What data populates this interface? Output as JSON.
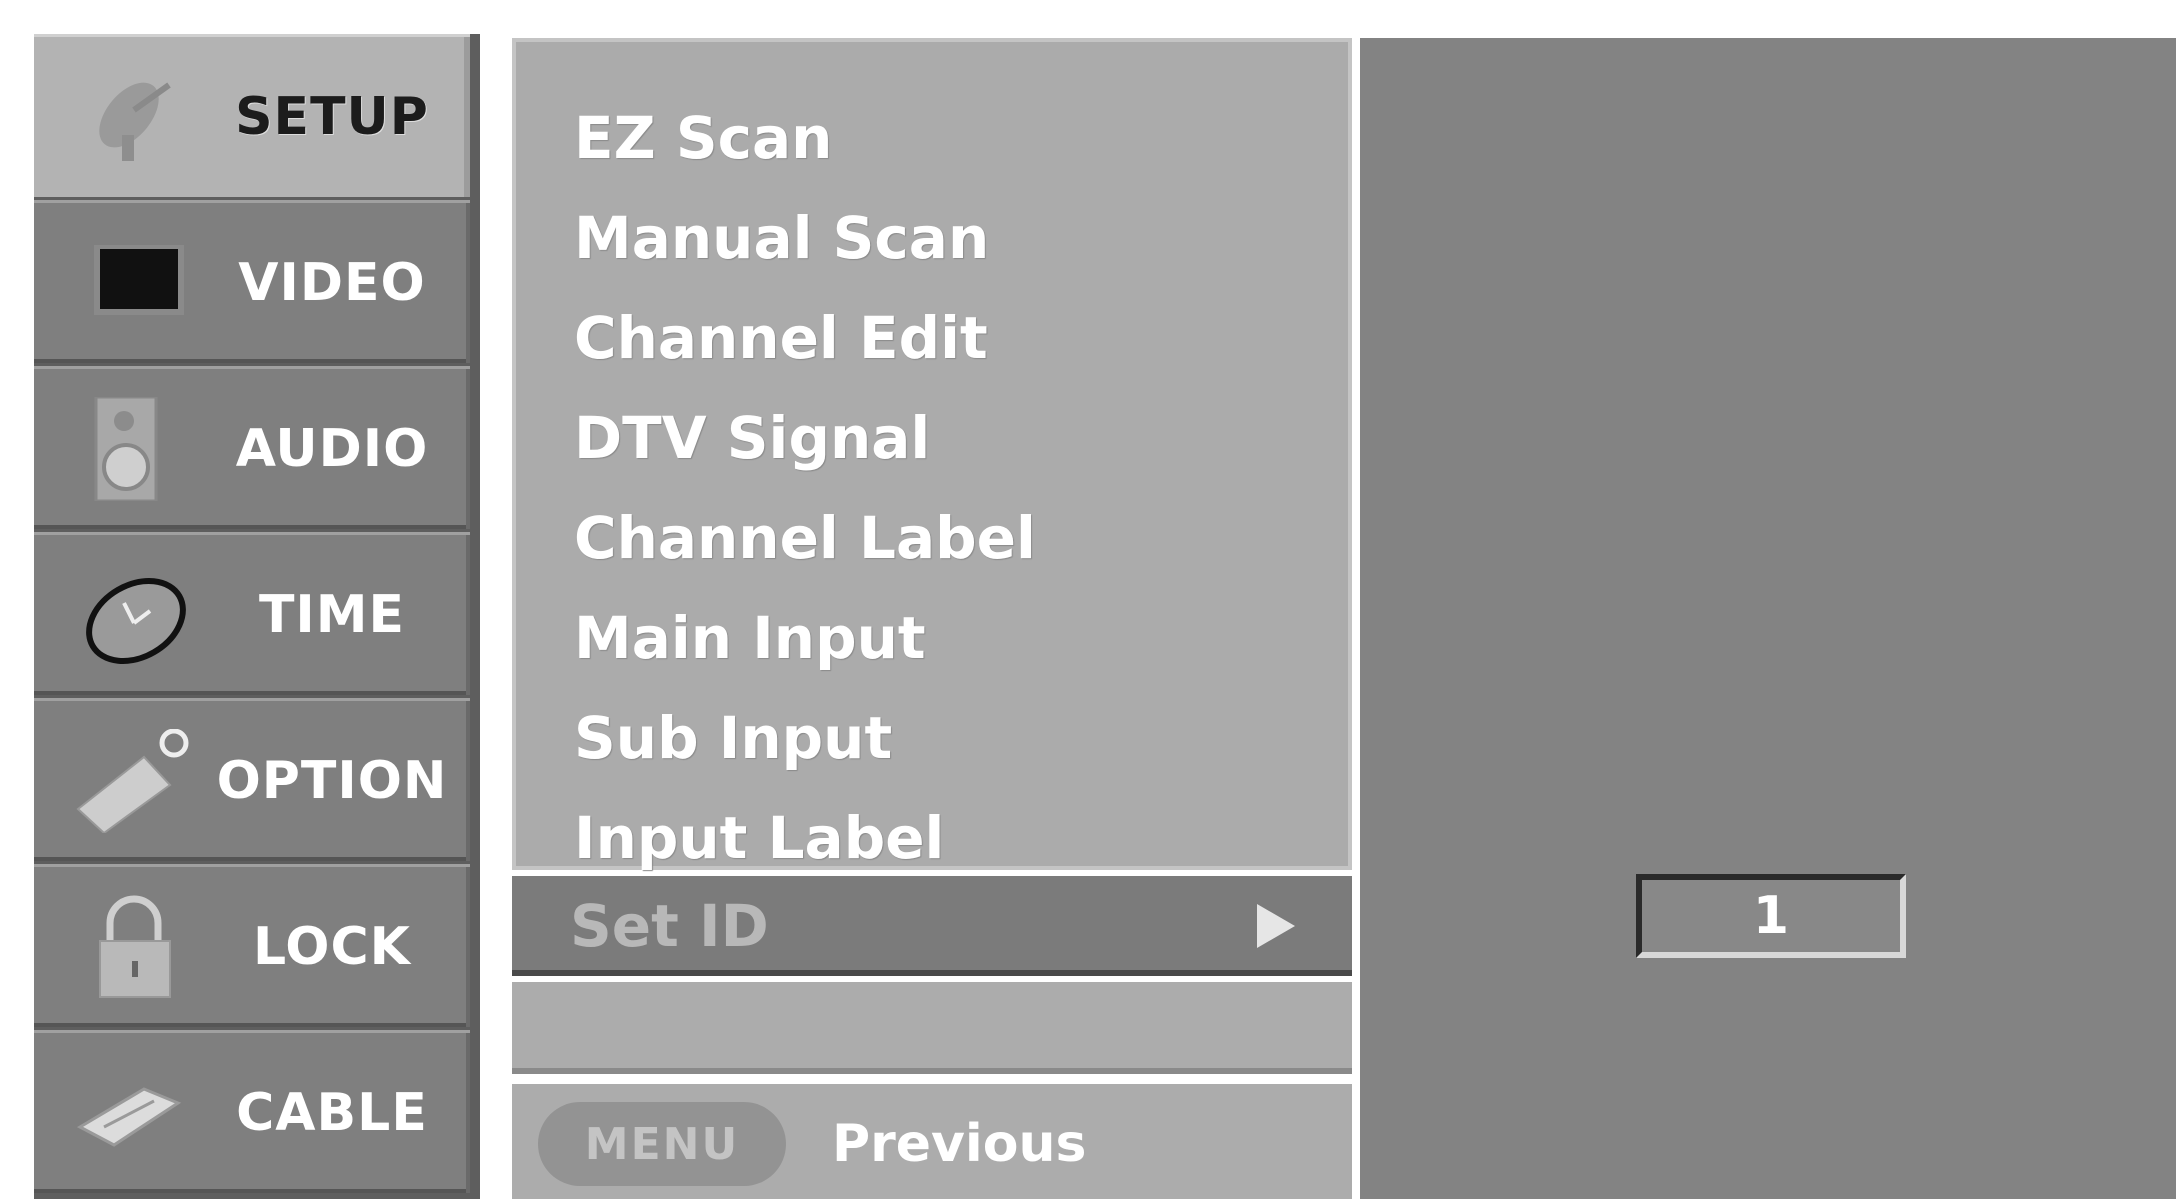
{
  "sidebar": {
    "items": [
      {
        "label": "SETUP",
        "icon": "satellite-dish-icon"
      },
      {
        "label": "VIDEO",
        "icon": "tv-screen-icon"
      },
      {
        "label": "AUDIO",
        "icon": "speaker-icon"
      },
      {
        "label": "TIME",
        "icon": "clock-icon"
      },
      {
        "label": "OPTION",
        "icon": "tag-icon"
      },
      {
        "label": "LOCK",
        "icon": "padlock-icon"
      },
      {
        "label": "CABLE",
        "icon": "cable-icon"
      }
    ],
    "active": "SETUP"
  },
  "menu": {
    "items": [
      "EZ Scan",
      "Manual Scan",
      "Channel Edit",
      "DTV Signal",
      "Channel Label",
      "Main Input",
      "Sub Input",
      "Input Label"
    ],
    "selected": "Set ID"
  },
  "footer": {
    "menu_button": "MENU",
    "previous_label": "Previous"
  },
  "value": {
    "set_id": "1"
  }
}
